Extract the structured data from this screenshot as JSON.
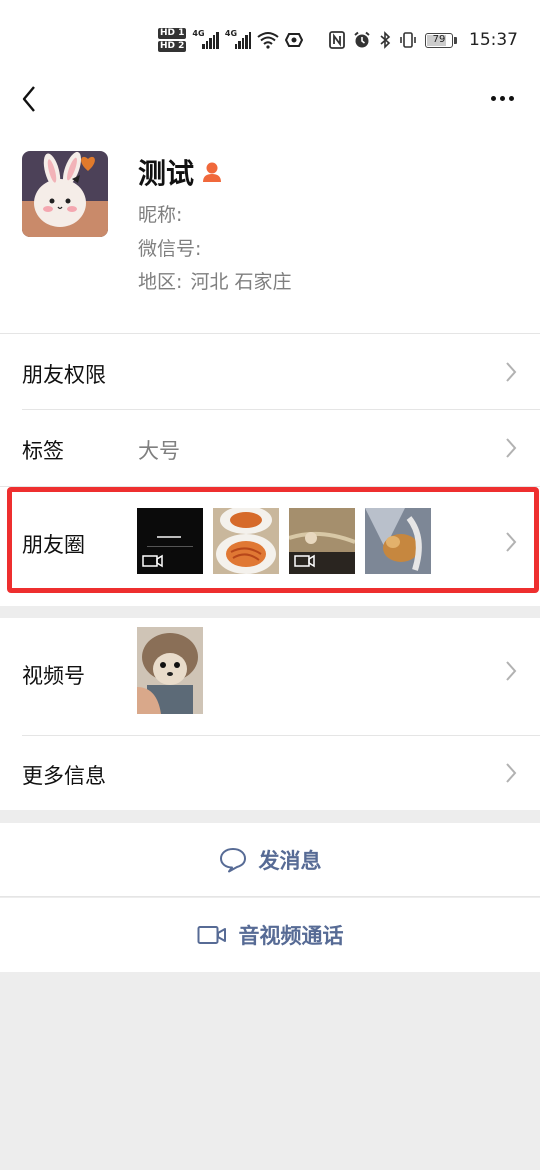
{
  "status_bar": {
    "sim1_badge": "HD 1",
    "sim2_badge": "HD 2",
    "network1": "4G",
    "network2": "4G",
    "battery": "79",
    "time": "15:37",
    "icons": [
      "signal-icon",
      "wifi-icon",
      "hotspot-icon",
      "nfc-icon",
      "alarm-icon",
      "bluetooth-icon",
      "vibrate-icon",
      "battery-icon"
    ]
  },
  "nav": {
    "back_icon": "chevron-left-icon",
    "more_icon": "more-dots-icon"
  },
  "profile": {
    "name": "测试",
    "gender_icon": "person-icon",
    "nickname_label": "昵称:",
    "nickname_value": "",
    "wechat_id_label": "微信号:",
    "wechat_id_value": "",
    "region_label": "地区:",
    "region_value": "河北  石家庄"
  },
  "rows": {
    "permissions": {
      "label": "朋友权限"
    },
    "tags": {
      "label": "标签",
      "value": "大号"
    },
    "moments": {
      "label": "朋友圈",
      "thumbnails": [
        {
          "kind": "video",
          "desc": "dark video"
        },
        {
          "kind": "image",
          "desc": "noodles plate"
        },
        {
          "kind": "video",
          "desc": "kitchen video"
        },
        {
          "kind": "image",
          "desc": "cat in bag"
        }
      ]
    },
    "channels": {
      "label": "视频号"
    },
    "more_info": {
      "label": "更多信息"
    }
  },
  "actions": {
    "send_message": "发消息",
    "video_call": "音视频通话"
  },
  "colors": {
    "link_blue": "#576b95",
    "highlight_red": "#ee2f2f",
    "gender_orange": "#f0683b",
    "background": "#ededed"
  }
}
